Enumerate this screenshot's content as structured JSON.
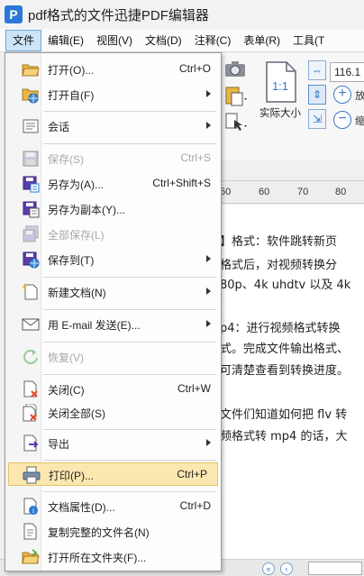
{
  "app": {
    "title": "pdf格式的文件迅捷PDF编辑器",
    "logo": "P"
  },
  "menubar": {
    "items": [
      "文件",
      "编辑(E)",
      "视图(V)",
      "文档(D)",
      "注释(C)",
      "表单(R)",
      "工具(T"
    ]
  },
  "toolbar": {
    "zoom_value": "116.1",
    "actual_size_label": "实际大小",
    "actual_size_icon_text": "1:1",
    "zoom_in_label": "放",
    "zoom_out_label": "缩"
  },
  "ruler": {
    "ticks": [
      "50",
      "60",
      "70",
      "80"
    ]
  },
  "document": {
    "lines": [
      "】格式：软件跳转新页",
      "格式后，对视频转换分",
      "80p、4k uhdtv 以及 4k",
      "",
      "p4：进行视频格式转换",
      "式。完成文件输出格式、",
      "可清楚查看到转换进度。",
      "",
      "文件们知道如何把 flv 转",
      "频格式转 mp4 的话，大"
    ]
  },
  "file_menu": {
    "items": [
      {
        "label": "打开(O)...",
        "shortcut": "Ctrl+O",
        "icon": "folder-open-icon"
      },
      {
        "label": "打开自(F)",
        "submenu": true,
        "icon": "folder-web-icon"
      },
      {
        "label": "会话",
        "submenu": true,
        "icon": "session-icon"
      },
      {
        "label": "保存(S)",
        "shortcut": "Ctrl+S",
        "disabled": true,
        "icon": "save-icon"
      },
      {
        "label": "另存为(A)...",
        "shortcut": "Ctrl+Shift+S",
        "icon": "save-as-icon"
      },
      {
        "label": "另存为副本(Y)...",
        "icon": "save-copy-icon"
      },
      {
        "label": "全部保存(L)",
        "disabled": true,
        "icon": "save-all-icon"
      },
      {
        "label": "保存到(T)",
        "submenu": true,
        "icon": "save-to-icon"
      },
      {
        "label": "新建文档(N)",
        "submenu": true,
        "icon": "new-document-icon"
      },
      {
        "label": "用 E-mail 发送(E)...",
        "submenu": true,
        "icon": "email-icon"
      },
      {
        "label": "恢复(V)",
        "disabled": true,
        "icon": "revert-icon"
      },
      {
        "label": "关闭(C)",
        "shortcut": "Ctrl+W",
        "icon": "close-document-icon"
      },
      {
        "label": "关闭全部(S)",
        "icon": "close-all-icon"
      },
      {
        "label": "导出",
        "submenu": true,
        "icon": "export-icon"
      },
      {
        "label": "打印(P)...",
        "shortcut": "Ctrl+P",
        "highlighted": true,
        "icon": "printer-icon"
      },
      {
        "label": "文档属性(D)...",
        "shortcut": "Ctrl+D",
        "icon": "document-properties-icon"
      },
      {
        "label": "复制完整的文件名(N)",
        "icon": "copy-filename-icon"
      },
      {
        "label": "打开所在文件夹(F)...",
        "icon": "open-folder-icon"
      }
    ]
  },
  "colors": {
    "accent": "#2b78d6",
    "highlight": "#fbe7b0",
    "menu_active": "#cde4f7"
  }
}
